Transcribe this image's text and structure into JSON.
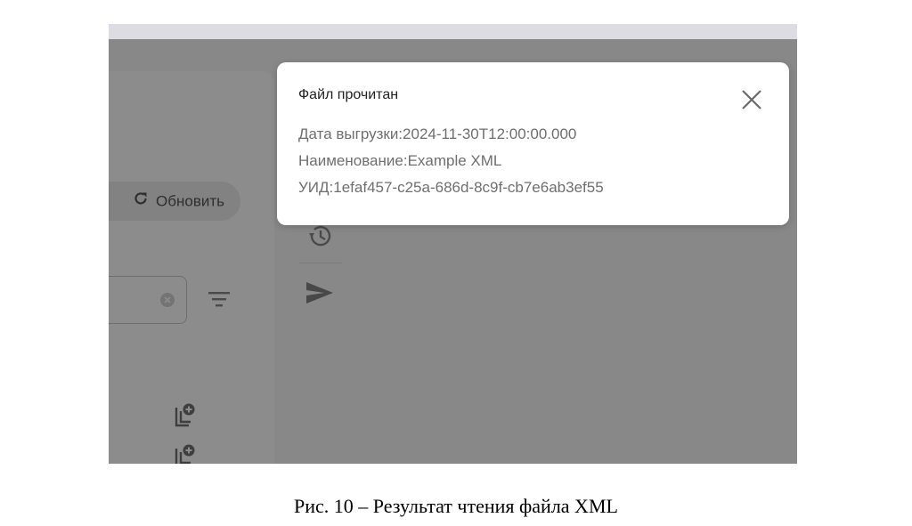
{
  "screenshot": {
    "refresh_label": "Обновить",
    "modal": {
      "title": "Файл прочитан",
      "date_line": "Дата выгрузки:2024-11-30T12:00:00.000",
      "name_line": "Наименование:Example XML",
      "uid_line": "УИД:1efaf457-c25a-686d-8c9f-cb7e6ab3ef55"
    },
    "icons": [
      "refresh-icon",
      "clear-icon",
      "filter-icon",
      "copy-add-icon",
      "history-icon",
      "send-icon",
      "close-icon"
    ]
  },
  "caption": "Рис. 10 – Результат чтения файла XML"
}
